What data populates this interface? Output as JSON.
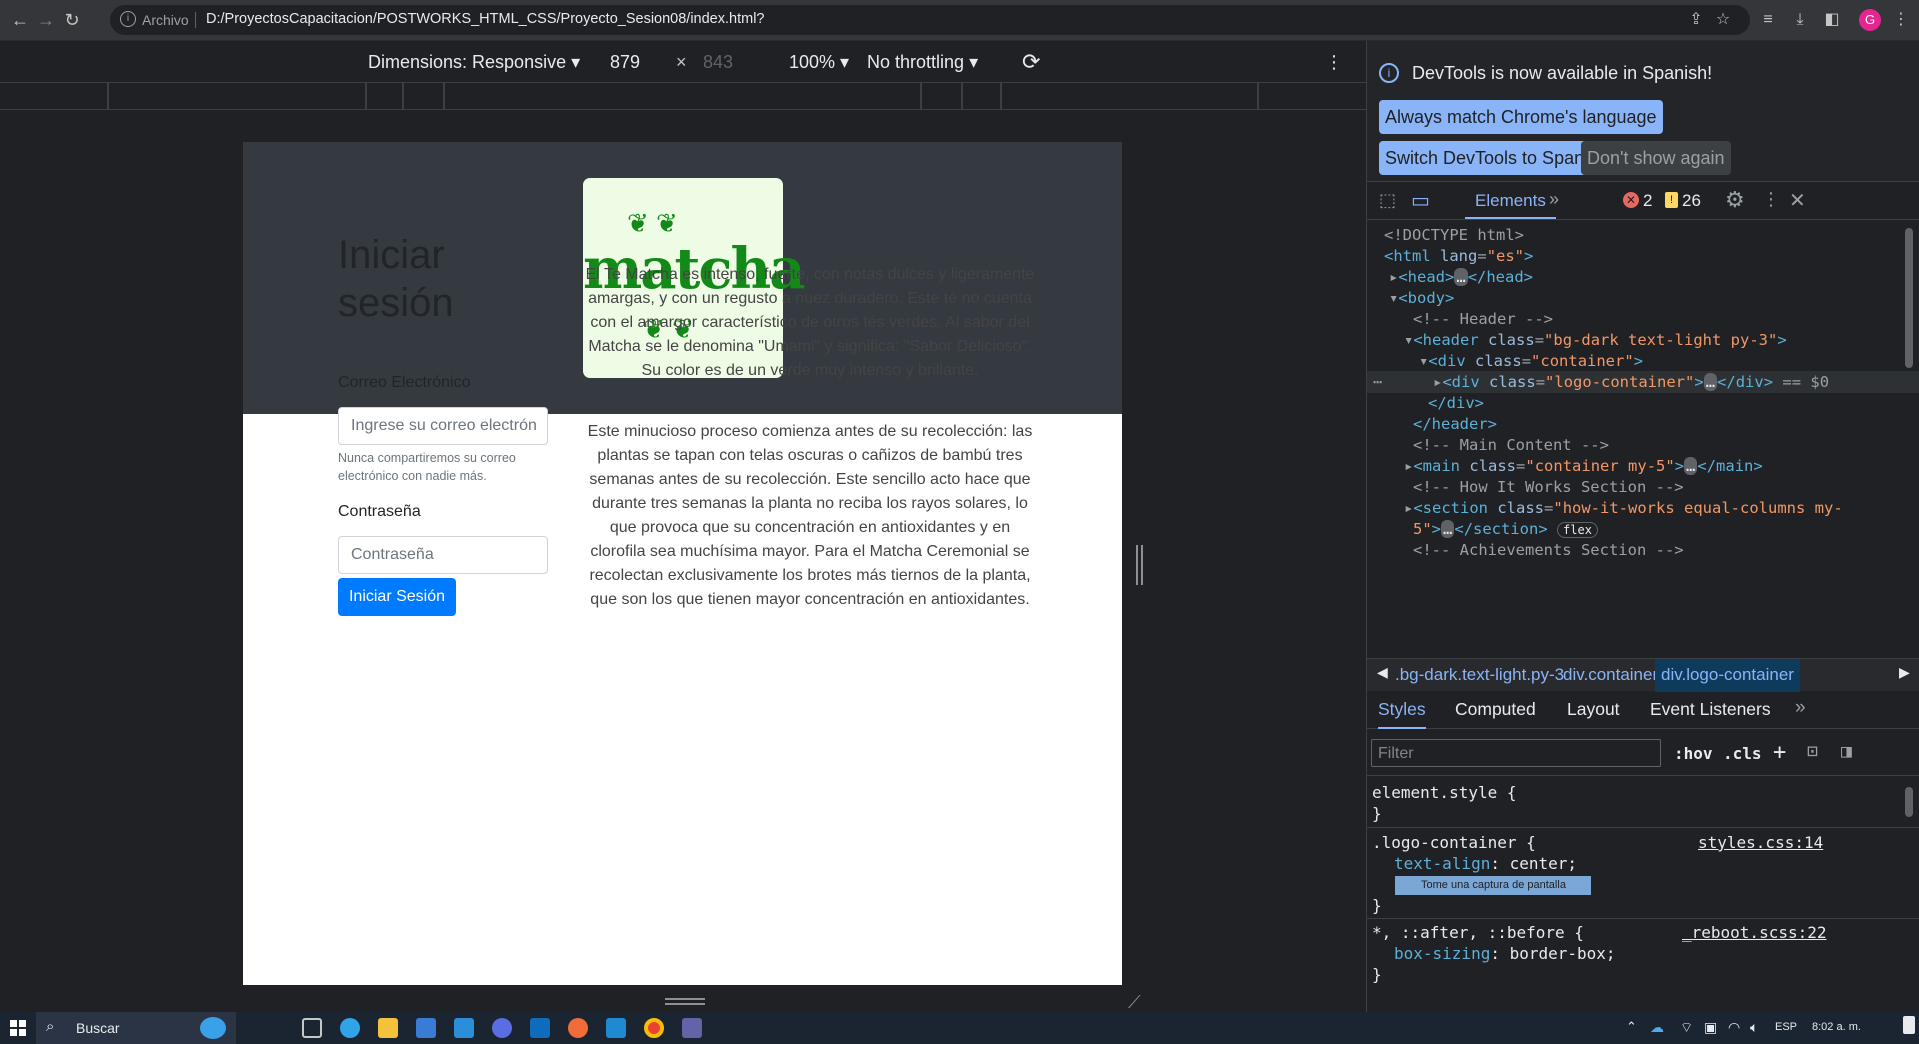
{
  "browser": {
    "origin_label": "Archivo",
    "url": "D:/ProyectosCapacitacion/POSTWORKS_HTML_CSS/Proyecto_Sesion08/index.html?",
    "avatar_letter": "G"
  },
  "device_toolbar": {
    "dimensions": "Dimensions: Responsive",
    "width": "879",
    "times": "×",
    "height": "843",
    "zoom": "100%",
    "throttling": "No throttling"
  },
  "page": {
    "logo_text": "matcha",
    "login": {
      "title": "Iniciar sesión",
      "email_label": "Correo Electrónico",
      "email_placeholder": "Ingrese su correo electrón",
      "email_help": "Nunca compartiremos su correo electrónico con nadie más.",
      "password_label": "Contraseña",
      "password_placeholder": "Contraseña",
      "submit": "Iniciar Sesión"
    },
    "paragraphs": [
      "El Te Matcha es intenso, fuerte, con notas dulces y ligeramente amargas, y con un regusto a nuez duradero. Este té no cuenta con el amargor característico de otros tés verdes. Al sabor del Matcha se le denomina \"Umami\" y significa: \"Sabor Delicioso\". Su color es de un verde muy intenso y brillante.",
      "Este minucioso proceso comienza antes de su recolección: las plantas se tapan con telas oscuras o cañizos de bambú tres semanas antes de su recolección. Este sencillo acto hace que durante tres semanas la planta no reciba los rayos solares, lo que provoca que su concentración en antioxidantes y en clorofila sea muchísima mayor. Para el Matcha Ceremonial se recolectan exclusivamente los brotes más tiernos de la planta, que son los que tienen mayor concentración en antioxidantes."
    ]
  },
  "devtools": {
    "banner_text": "DevTools is now available in Spanish!",
    "btn_match": "Always match Chrome's language",
    "btn_switch": "Switch DevTools to Spanish",
    "btn_dont": "Don't show again",
    "tab_elements": "Elements",
    "errors": "2",
    "warnings": "26",
    "dom": {
      "doctype": "<!DOCTYPE html>",
      "html_open": "<html",
      "lang_attr": "lang",
      "lang_val": "\"es\"",
      "gt": ">",
      "head": "<head>",
      "head_close": "</head>",
      "body": "<body>",
      "c_header": "<!-- Header -->",
      "header_tag": "<header",
      "class_attr": "class",
      "header_class": "\"bg-dark text-light py-3\"",
      "div_tag": "<div",
      "container_class": "\"container\"",
      "logo_class": "\"logo-container\"",
      "div_close": "</div>",
      "eq0": "== $0",
      "header_close": "</header>",
      "c_main": "<!-- Main Content -->",
      "main_tag": "<main",
      "main_class": "\"container my-5\"",
      "main_close": "</main>",
      "c_how": "<!-- How It Works Section -->",
      "section_tag": "<section",
      "section_class_a": "\"how-it-works equal-columns my-",
      "section_class_b": "5\"",
      "section_close": "</section>",
      "flex_badge": "flex",
      "c_ach": "<!-- Achievements Section -->"
    },
    "breadcrumbs": [
      ".bg-dark.text-light.py-3",
      "div.container",
      "div.logo-container"
    ],
    "style_tabs": [
      "Styles",
      "Computed",
      "Layout",
      "Event Listeners"
    ],
    "filter_placeholder": "Filter",
    "hov": ":hov",
    "cls": ".cls",
    "styles": {
      "element_style": "element.style {",
      "close_brace": "}",
      "logo_selector": ".logo-container {",
      "logo_source": "styles.css:14",
      "prop_text_align": "text-align",
      "val_center": "center;",
      "tooltip": "Tome una captura de pantalla",
      "universal_selector": "*, ::after, ::before {",
      "reboot_source": "_reboot.scss:22",
      "prop_box_sizing": "box-sizing",
      "val_border_box": "border-box;"
    }
  },
  "taskbar": {
    "search": "Buscar",
    "lang": "ESP",
    "time": "8:02 a. m."
  }
}
